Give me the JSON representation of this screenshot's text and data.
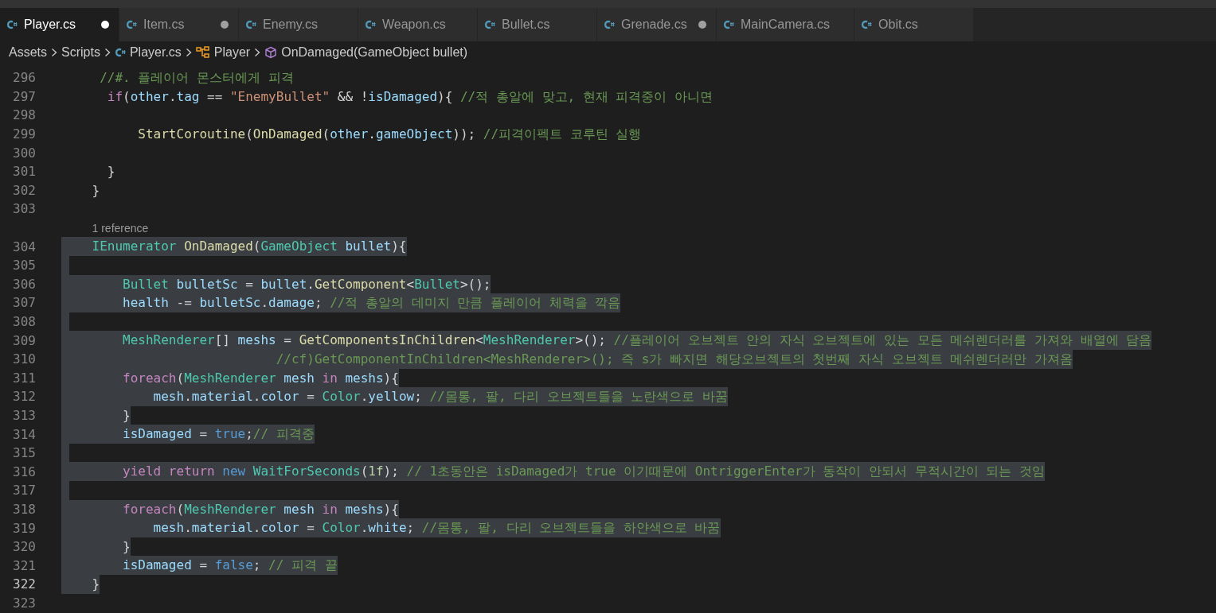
{
  "tabs": [
    {
      "label": "Player.cs",
      "selected": true,
      "modified": true
    },
    {
      "label": "Item.cs",
      "selected": false,
      "modified": true
    },
    {
      "label": "Enemy.cs",
      "selected": false,
      "modified": false
    },
    {
      "label": "Weapon.cs",
      "selected": false,
      "modified": false
    },
    {
      "label": "Bullet.cs",
      "selected": false,
      "modified": false
    },
    {
      "label": "Grenade.cs",
      "selected": false,
      "modified": true
    },
    {
      "label": "MainCamera.cs",
      "selected": false,
      "modified": false
    },
    {
      "label": "Obit.cs",
      "selected": false,
      "modified": false
    }
  ],
  "breadcrumb": [
    {
      "text": "Assets",
      "kind": "folder"
    },
    {
      "text": "Scripts",
      "kind": "folder"
    },
    {
      "text": "Player.cs",
      "kind": "file"
    },
    {
      "text": "Player",
      "kind": "class"
    },
    {
      "text": "OnDamaged(GameObject bullet)",
      "kind": "method"
    }
  ],
  "editor": {
    "lines": [
      {
        "number": "296",
        "selected": false,
        "current": false,
        "tokens": [
          {
            "text": "     //#. 플레이어 몬스터에게 피격",
            "kind": "comment"
          }
        ]
      },
      {
        "number": "297",
        "selected": false,
        "current": false,
        "tokens": [
          {
            "text": "      if",
            "kind": "control"
          },
          {
            "text": "(",
            "kind": "plain"
          },
          {
            "text": "other",
            "kind": "variable"
          },
          {
            "text": ".",
            "kind": "plain"
          },
          {
            "text": "tag",
            "kind": "variable"
          },
          {
            "text": " == ",
            "kind": "plain"
          },
          {
            "text": "\"EnemyBullet\"",
            "kind": "string"
          },
          {
            "text": " && !",
            "kind": "plain"
          },
          {
            "text": "isDamaged",
            "kind": "variable"
          },
          {
            "text": "){ ",
            "kind": "plain"
          },
          {
            "text": "//적 총알에 맞고, 현재 피격중이 아니면",
            "kind": "comment"
          }
        ]
      },
      {
        "number": "298",
        "selected": false,
        "current": false
      },
      {
        "number": "299",
        "selected": false,
        "current": false,
        "tokens": [
          {
            "text": "          StartCoroutine",
            "kind": "function"
          },
          {
            "text": "(",
            "kind": "plain"
          },
          {
            "text": "OnDamaged",
            "kind": "function"
          },
          {
            "text": "(",
            "kind": "plain"
          },
          {
            "text": "other",
            "kind": "variable"
          },
          {
            "text": ".",
            "kind": "plain"
          },
          {
            "text": "gameObject",
            "kind": "variable"
          },
          {
            "text": ")); ",
            "kind": "plain"
          },
          {
            "text": "//피격이펙트 코루틴 실행",
            "kind": "comment"
          }
        ]
      },
      {
        "number": "300",
        "selected": false,
        "current": false
      },
      {
        "number": "301",
        "selected": false,
        "current": false,
        "tokens": [
          {
            "text": "      }",
            "kind": "plain"
          }
        ]
      },
      {
        "number": "302",
        "selected": false,
        "current": false,
        "tokens": [
          {
            "text": "    }",
            "kind": "plain"
          }
        ]
      },
      {
        "number": "303",
        "selected": false,
        "current": false
      },
      {
        "number": "304",
        "selected": true,
        "current": false,
        "codelens": "1 reference",
        "tokens": [
          {
            "text": "    IEnumerator",
            "kind": "type"
          },
          {
            "text": " OnDamaged",
            "kind": "function"
          },
          {
            "text": "(",
            "kind": "plain"
          },
          {
            "text": "GameObject",
            "kind": "type"
          },
          {
            "text": " bullet",
            "kind": "variable"
          },
          {
            "text": "){",
            "kind": "plain"
          }
        ]
      },
      {
        "number": "305",
        "selected": true,
        "current": false
      },
      {
        "number": "306",
        "selected": true,
        "current": false,
        "tokens": [
          {
            "text": "        Bullet",
            "kind": "type"
          },
          {
            "text": " bulletSc",
            "kind": "variable"
          },
          {
            "text": " = ",
            "kind": "plain"
          },
          {
            "text": "bullet",
            "kind": "variable"
          },
          {
            "text": ".",
            "kind": "plain"
          },
          {
            "text": "GetComponent",
            "kind": "function"
          },
          {
            "text": "<",
            "kind": "plain"
          },
          {
            "text": "Bullet",
            "kind": "type"
          },
          {
            "text": ">();",
            "kind": "plain"
          }
        ]
      },
      {
        "number": "307",
        "selected": true,
        "current": false,
        "tokens": [
          {
            "text": "        health",
            "kind": "variable"
          },
          {
            "text": " -= ",
            "kind": "plain"
          },
          {
            "text": "bulletSc",
            "kind": "variable"
          },
          {
            "text": ".",
            "kind": "plain"
          },
          {
            "text": "damage",
            "kind": "variable"
          },
          {
            "text": "; ",
            "kind": "plain"
          },
          {
            "text": "//적 총알의 데미지 만큼 플레이어 체력을 깍음",
            "kind": "comment"
          }
        ]
      },
      {
        "number": "308",
        "selected": true,
        "current": false
      },
      {
        "number": "309",
        "selected": true,
        "current": false,
        "tokens": [
          {
            "text": "        MeshRenderer",
            "kind": "type"
          },
          {
            "text": "[] ",
            "kind": "plain"
          },
          {
            "text": "meshs",
            "kind": "variable"
          },
          {
            "text": " = ",
            "kind": "plain"
          },
          {
            "text": "GetComponentsInChildren",
            "kind": "function"
          },
          {
            "text": "<",
            "kind": "plain"
          },
          {
            "text": "MeshRenderer",
            "kind": "type"
          },
          {
            "text": ">(); ",
            "kind": "plain"
          },
          {
            "text": "//플레이어 오브젝트 안의 자식 오브젝트에 있는 모든 메쉬렌더러를 가져와 배열에 담음",
            "kind": "comment"
          }
        ]
      },
      {
        "number": "310",
        "selected": true,
        "current": false,
        "tokens": [
          {
            "text": "                            //cf)GetComponentInChildren<MeshRenderer>(); 즉 s가 빠지면 해당오브젝트의 첫번째 자식 오브젝트 메쉬렌더러만 가져옴",
            "kind": "comment"
          }
        ]
      },
      {
        "number": "311",
        "selected": true,
        "current": false,
        "tokens": [
          {
            "text": "        foreach",
            "kind": "control"
          },
          {
            "text": "(",
            "kind": "plain"
          },
          {
            "text": "MeshRenderer",
            "kind": "type"
          },
          {
            "text": " mesh",
            "kind": "variable"
          },
          {
            "text": " in",
            "kind": "control"
          },
          {
            "text": " meshs",
            "kind": "variable"
          },
          {
            "text": "){",
            "kind": "plain"
          }
        ]
      },
      {
        "number": "312",
        "selected": true,
        "current": false,
        "tokens": [
          {
            "text": "            mesh",
            "kind": "variable"
          },
          {
            "text": ".",
            "kind": "plain"
          },
          {
            "text": "material",
            "kind": "variable"
          },
          {
            "text": ".",
            "kind": "plain"
          },
          {
            "text": "color",
            "kind": "variable"
          },
          {
            "text": " = ",
            "kind": "plain"
          },
          {
            "text": "Color",
            "kind": "type"
          },
          {
            "text": ".",
            "kind": "plain"
          },
          {
            "text": "yellow",
            "kind": "variable"
          },
          {
            "text": "; ",
            "kind": "plain"
          },
          {
            "text": "//몸통, 팔, 다리 오브젝트들을 노란색으로 바꿈",
            "kind": "comment"
          }
        ]
      },
      {
        "number": "313",
        "selected": true,
        "current": false,
        "tokens": [
          {
            "text": "        }",
            "kind": "plain"
          }
        ]
      },
      {
        "number": "314",
        "selected": true,
        "current": false,
        "tokens": [
          {
            "text": "        isDamaged",
            "kind": "variable"
          },
          {
            "text": " = ",
            "kind": "plain"
          },
          {
            "text": "true",
            "kind": "keyword"
          },
          {
            "text": ";",
            "kind": "plain"
          },
          {
            "text": "// 피격중",
            "kind": "comment"
          }
        ]
      },
      {
        "number": "315",
        "selected": true,
        "current": false
      },
      {
        "number": "316",
        "selected": true,
        "current": false,
        "tokens": [
          {
            "text": "        yield",
            "kind": "control"
          },
          {
            "text": " return",
            "kind": "control"
          },
          {
            "text": " new",
            "kind": "keyword"
          },
          {
            "text": " WaitForSeconds",
            "kind": "type"
          },
          {
            "text": "(",
            "kind": "plain"
          },
          {
            "text": "1f",
            "kind": "number"
          },
          {
            "text": "); ",
            "kind": "plain"
          },
          {
            "text": "// 1초동안은 isDamaged가 true 이기때문에 OntriggerEnter가 동작이 안되서 무적시간이 되는 것임",
            "kind": "comment"
          }
        ]
      },
      {
        "number": "317",
        "selected": true,
        "current": false
      },
      {
        "number": "318",
        "selected": true,
        "current": false,
        "tokens": [
          {
            "text": "        foreach",
            "kind": "control"
          },
          {
            "text": "(",
            "kind": "plain"
          },
          {
            "text": "MeshRenderer",
            "kind": "type"
          },
          {
            "text": " mesh",
            "kind": "variable"
          },
          {
            "text": " in",
            "kind": "control"
          },
          {
            "text": " meshs",
            "kind": "variable"
          },
          {
            "text": "){",
            "kind": "plain"
          }
        ]
      },
      {
        "number": "319",
        "selected": true,
        "current": false,
        "tokens": [
          {
            "text": "            mesh",
            "kind": "variable"
          },
          {
            "text": ".",
            "kind": "plain"
          },
          {
            "text": "material",
            "kind": "variable"
          },
          {
            "text": ".",
            "kind": "plain"
          },
          {
            "text": "color",
            "kind": "variable"
          },
          {
            "text": " = ",
            "kind": "plain"
          },
          {
            "text": "Color",
            "kind": "type"
          },
          {
            "text": ".",
            "kind": "plain"
          },
          {
            "text": "white",
            "kind": "variable"
          },
          {
            "text": "; ",
            "kind": "plain"
          },
          {
            "text": "//몸통, 팔, 다리 오브젝트들을 하얀색으로 바꿈",
            "kind": "comment"
          }
        ]
      },
      {
        "number": "320",
        "selected": true,
        "current": false,
        "tokens": [
          {
            "text": "        }",
            "kind": "plain"
          }
        ]
      },
      {
        "number": "321",
        "selected": true,
        "current": false,
        "tokens": [
          {
            "text": "        isDamaged",
            "kind": "variable"
          },
          {
            "text": " = ",
            "kind": "plain"
          },
          {
            "text": "false",
            "kind": "keyword"
          },
          {
            "text": "; ",
            "kind": "plain"
          },
          {
            "text": "// 피격 끝",
            "kind": "comment"
          }
        ]
      },
      {
        "number": "322",
        "selected": true,
        "current": true,
        "tokens": [
          {
            "text": "    }",
            "kind": "plain"
          }
        ]
      },
      {
        "number": "323",
        "selected": false,
        "current": false
      }
    ]
  }
}
